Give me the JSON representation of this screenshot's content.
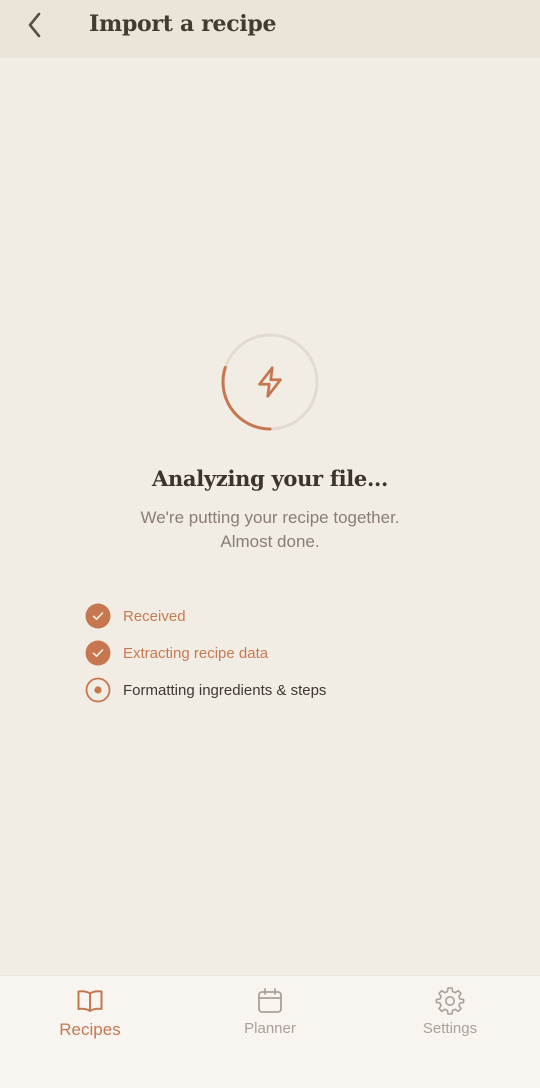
{
  "header": {
    "title": "Import a recipe",
    "back_icon": "chevron-left-icon"
  },
  "status": {
    "icon": "lightning-bolt-icon",
    "title": "Analyzing your file...",
    "subtitle_line1": "We're putting your recipe together.",
    "subtitle_line2": "Almost done.",
    "progress_fraction": 0.3
  },
  "steps": [
    {
      "label": "Received",
      "state": "done"
    },
    {
      "label": "Extracting recipe data",
      "state": "done"
    },
    {
      "label": "Formatting ingredients & steps",
      "state": "active"
    }
  ],
  "tabs": [
    {
      "label": "Recipes",
      "icon": "book-icon",
      "active": true
    },
    {
      "label": "Planner",
      "icon": "calendar-icon",
      "active": false
    },
    {
      "label": "Settings",
      "icon": "gear-icon",
      "active": false
    }
  ],
  "colors": {
    "accent": "#c7774f",
    "background": "#f1ece4",
    "header": "#ebe4d9",
    "ring_track": "#e3dbcf",
    "text_dark": "#3b332c",
    "text_muted": "#8a7e73",
    "tab_inactive": "#aaa096"
  }
}
